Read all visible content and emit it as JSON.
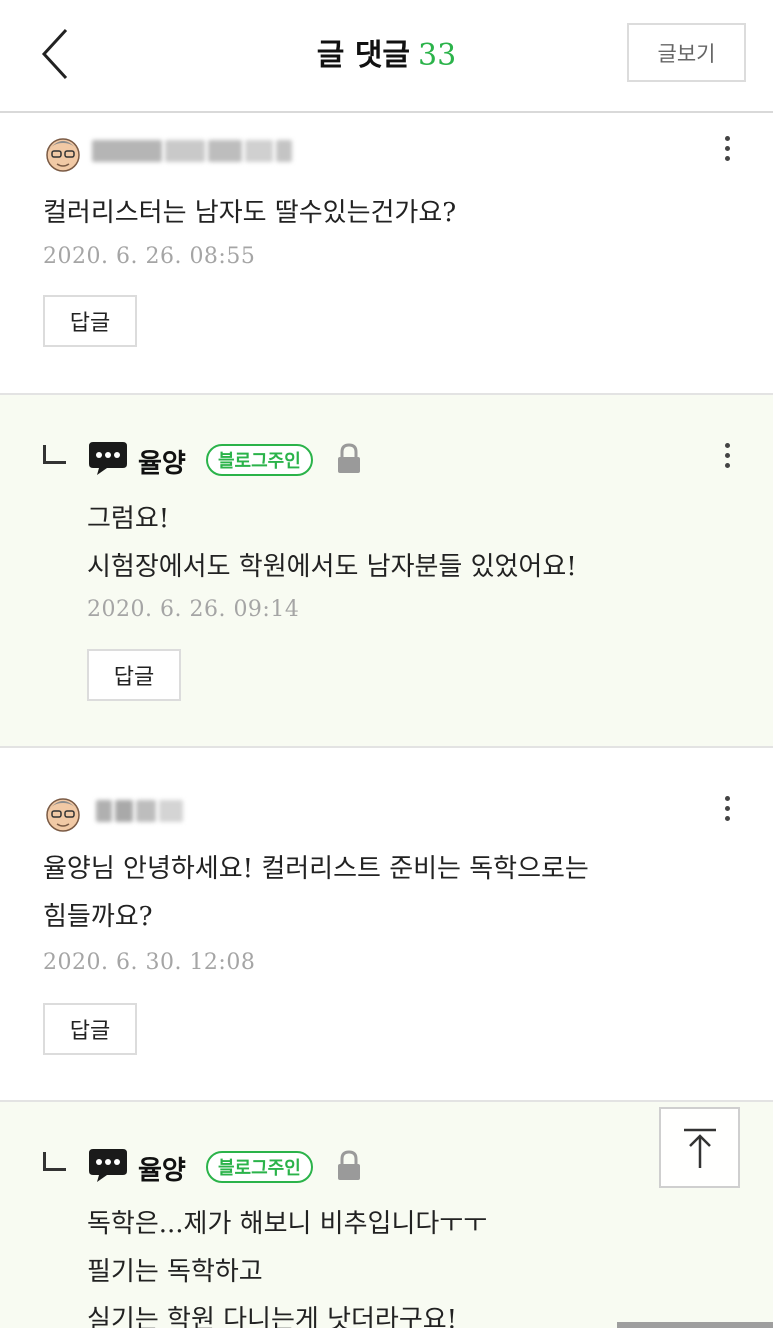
{
  "header": {
    "title": "글 댓글",
    "count": "33",
    "view_post_label": "글보기"
  },
  "comments": [
    {
      "text_lines": [
        "컬러리스터는 남자도 딸수있는건가요?"
      ],
      "date": "2020. 6. 26. 08:55",
      "reply_label": "답글"
    },
    {
      "author": "율양",
      "badge": "블로그주인",
      "text_lines": [
        "그럼요!",
        "시험장에서도 학원에서도 남자분들 있었어요!"
      ],
      "date": "2020. 6. 26. 09:14",
      "reply_label": "답글"
    },
    {
      "text_lines": [
        "율양님 안녕하세요! 컬러리스트 준비는 독학으로는",
        "힘들까요?"
      ],
      "date": "2020. 6. 30. 12:08",
      "reply_label": "답글"
    },
    {
      "author": "율양",
      "badge": "블로그주인",
      "text_lines": [
        "독학은...제가 해보니 비추입니다ㅜㅜ",
        "필기는 독학하고",
        "실기는 학원 다니는게 낫더라구요!"
      ]
    }
  ],
  "colors": {
    "accent": "#2bb34a",
    "reply_bg": "#f8fbf2",
    "date": "#a5a5a5"
  }
}
